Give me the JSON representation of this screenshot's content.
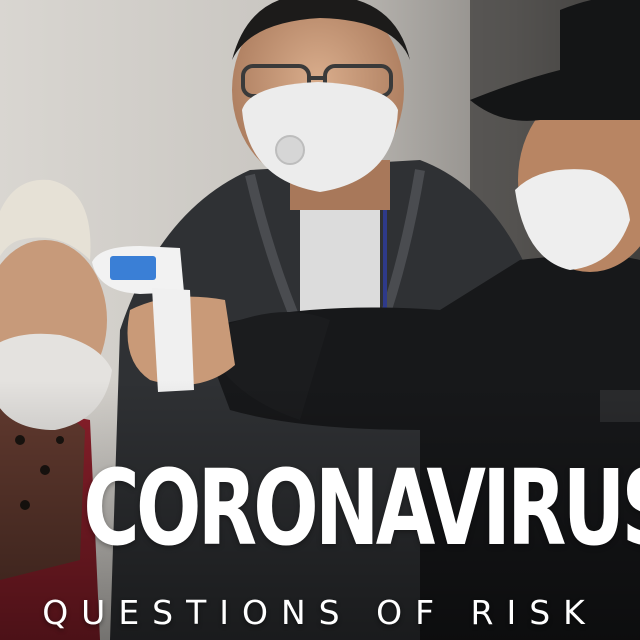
{
  "overlay": {
    "title": "CORONAVIRUS",
    "subtitle": "QUESTIONS OF RISK"
  },
  "colors": {
    "title_text": "#ffffff",
    "background": "#2a2a2a"
  }
}
